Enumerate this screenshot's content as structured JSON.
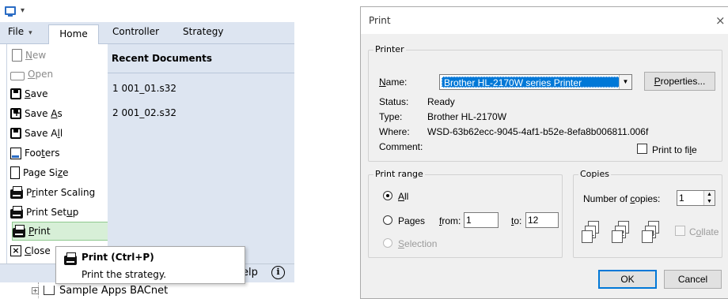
{
  "app": {
    "tabs": {
      "file": "File",
      "home": "Home",
      "controller": "Controller",
      "strategy": "Strategy"
    },
    "file_menu": [
      {
        "label": "New",
        "icon": "new-document-icon",
        "disabled": true
      },
      {
        "label": "Open",
        "icon": "open-folder-icon",
        "disabled": true
      },
      {
        "label": "Save",
        "icon": "save-icon",
        "disabled": false
      },
      {
        "label": "Save As",
        "icon": "save-as-icon",
        "disabled": false
      },
      {
        "label": "Save All",
        "icon": "save-all-icon",
        "disabled": false
      },
      {
        "label": "Footers",
        "icon": "footers-icon",
        "disabled": false
      },
      {
        "label": "Page Size",
        "icon": "page-size-icon",
        "disabled": false
      },
      {
        "label": "Printer Scaling",
        "icon": "printer-scaling-icon",
        "disabled": false
      },
      {
        "label": "Print Setup",
        "icon": "print-setup-icon",
        "disabled": false
      },
      {
        "label": "Print",
        "icon": "print-icon",
        "disabled": false,
        "selected": true
      },
      {
        "label": "Close",
        "icon": "close-icon",
        "disabled": false
      }
    ],
    "recent": {
      "title": "Recent Documents",
      "items": [
        "1 001_01.s32",
        "2 001_02.s32"
      ]
    },
    "tooltip": {
      "title": "Print (Ctrl+P)",
      "description": "Print the strategy."
    },
    "help_label": "elp",
    "tree_item": "Sample Apps BACnet"
  },
  "print_dialog": {
    "title": "Print",
    "close_glyph": "×",
    "printer": {
      "group_label": "Printer",
      "name_label": "Name:",
      "name_value": "Brother HL-2170W series Printer",
      "properties_button": "Properties...",
      "status_label": "Status:",
      "status_value": "Ready",
      "type_label": "Type:",
      "type_value": "Brother HL-2170W",
      "where_label": "Where:",
      "where_value": "WSD-63b62ecc-9045-4af1-b52e-8efa8b006811.006f",
      "comment_label": "Comment:",
      "print_to_file": "Print to file"
    },
    "range": {
      "group_label": "Print range",
      "all": "All",
      "pages": "Pages",
      "from_label": "from:",
      "from_value": "1",
      "to_label": "to:",
      "to_value": "12",
      "selection": "Selection"
    },
    "copies": {
      "group_label": "Copies",
      "number_label": "Number of copies:",
      "number_value": "1",
      "collate": "Collate"
    },
    "ok_button": "OK",
    "cancel_button": "Cancel"
  }
}
